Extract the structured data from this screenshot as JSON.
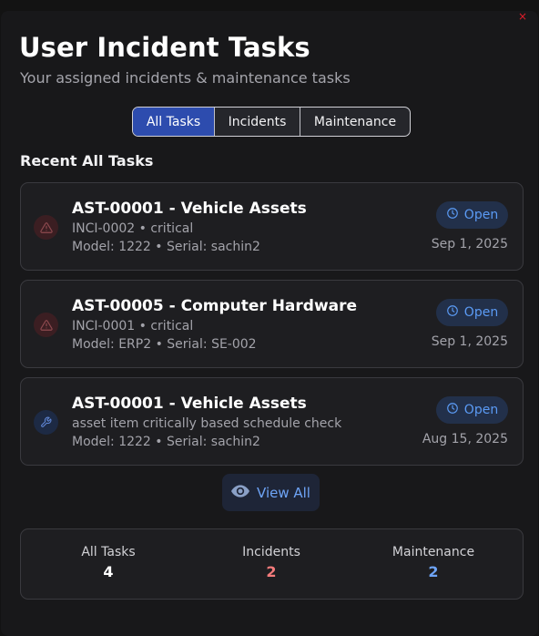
{
  "close_icon": "×",
  "header": {
    "title": "User Incident Tasks",
    "subtitle": "Your assigned incidents & maintenance tasks"
  },
  "tabs": [
    {
      "label": "All Tasks",
      "active": true
    },
    {
      "label": "Incidents",
      "active": false
    },
    {
      "label": "Maintenance",
      "active": false
    }
  ],
  "section_title": "Recent All Tasks",
  "tasks": [
    {
      "icon": "warning-icon",
      "title": "AST-00001 - Vehicle Assets",
      "line1": "INCI-0002 • critical",
      "line2": "Model: 1222 • Serial: sachin2",
      "status": "Open",
      "date": "Sep 1, 2025"
    },
    {
      "icon": "warning-icon",
      "title": "AST-00005 - Computer Hardware",
      "line1": "INCI-0001 • critical",
      "line2": "Model: ERP2 • Serial: SE-002",
      "status": "Open",
      "date": "Sep 1, 2025"
    },
    {
      "icon": "wrench-icon",
      "title": "AST-00001 - Vehicle Assets",
      "line1": "asset item critically based schedule check",
      "line2": "Model: 1222 • Serial: sachin2",
      "status": "Open",
      "date": "Aug 15, 2025"
    }
  ],
  "view_all_label": "View All",
  "summary": [
    {
      "label": "All Tasks",
      "value": "4",
      "color": "#ffffff"
    },
    {
      "label": "Incidents",
      "value": "2",
      "color": "#f47b7b"
    },
    {
      "label": "Maintenance",
      "value": "2",
      "color": "#6ea4f6"
    }
  ],
  "colors": {
    "accent": "#2d4cae",
    "open_badge_text": "#5b9bf5",
    "danger": "#e11d2a"
  }
}
